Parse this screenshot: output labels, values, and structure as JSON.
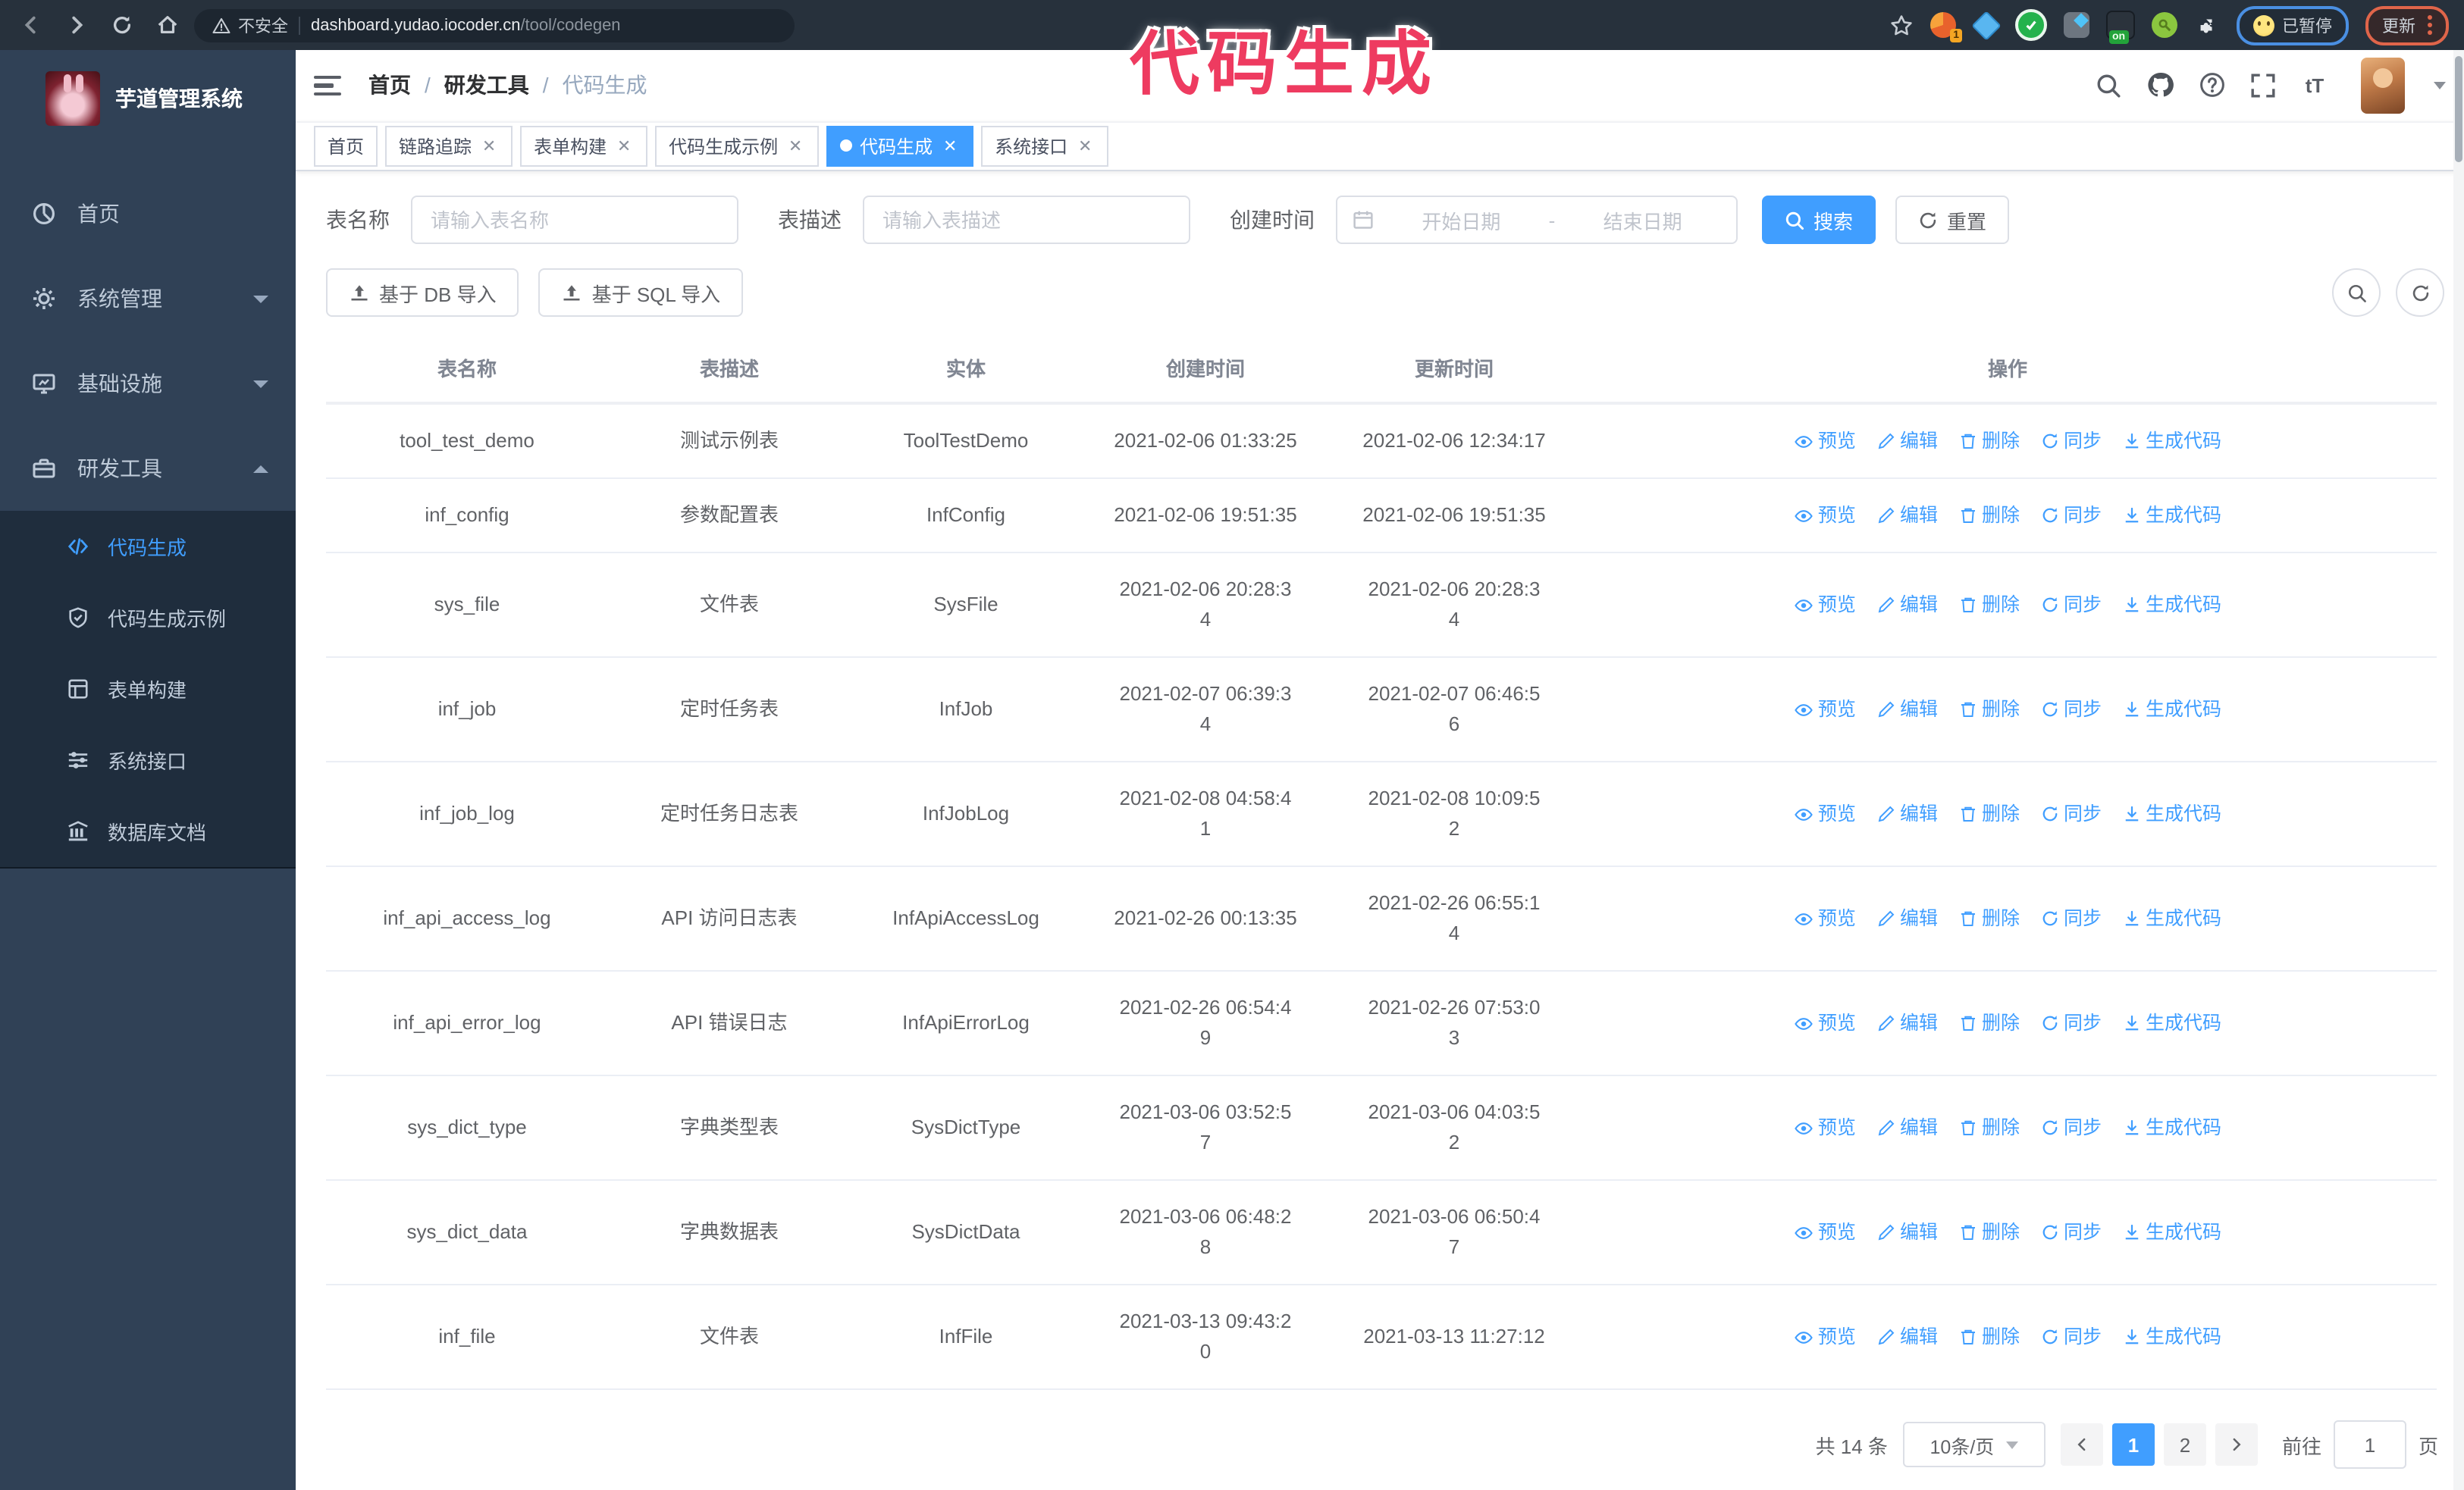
{
  "browser": {
    "security_label": "不安全",
    "url_domain": "dashboard.yudao.iocoder.cn",
    "url_path": "/tool/codegen",
    "extension_badge": "1",
    "extension_on_badge": "on",
    "paused_label": "已暂停",
    "update_label": "更新"
  },
  "overlay": {
    "text": "代码生成",
    "color": "#ee3b60"
  },
  "sidebar": {
    "title": "芋道管理系统",
    "items": [
      {
        "label": "首页"
      },
      {
        "label": "系统管理"
      },
      {
        "label": "基础设施"
      },
      {
        "label": "研发工具"
      }
    ],
    "subitems": [
      {
        "label": "代码生成",
        "active": true
      },
      {
        "label": "代码生成示例"
      },
      {
        "label": "表单构建"
      },
      {
        "label": "系统接口"
      },
      {
        "label": "数据库文档"
      }
    ]
  },
  "navbar": {
    "breadcrumb": [
      "首页",
      "研发工具",
      "代码生成"
    ],
    "separator": "/"
  },
  "tags": [
    {
      "label": "首页"
    },
    {
      "label": "链路追踪"
    },
    {
      "label": "表单构建"
    },
    {
      "label": "代码生成示例"
    },
    {
      "label": "代码生成",
      "active": true
    },
    {
      "label": "系统接口"
    }
  ],
  "filters": {
    "name_label": "表名称",
    "name_placeholder": "请输入表名称",
    "desc_label": "表描述",
    "desc_placeholder": "请输入表描述",
    "time_label": "创建时间",
    "start_placeholder": "开始日期",
    "range_separator": "-",
    "end_placeholder": "结束日期",
    "search_label": "搜索",
    "reset_label": "重置"
  },
  "toolbar": {
    "import_db_label": "基于 DB 导入",
    "import_sql_label": "基于 SQL 导入"
  },
  "table": {
    "headers": [
      "表名称",
      "表描述",
      "实体",
      "创建时间",
      "更新时间",
      "操作"
    ],
    "actions": [
      "预览",
      "编辑",
      "删除",
      "同步",
      "生成代码"
    ],
    "rows": [
      {
        "name": "tool_test_demo",
        "desc": "测试示例表",
        "entity": "ToolTestDemo",
        "created": "2021-02-06 01:33:25",
        "updated": "2021-02-06 12:34:17"
      },
      {
        "name": "inf_config",
        "desc": "参数配置表",
        "entity": "InfConfig",
        "created": "2021-02-06 19:51:35",
        "updated": "2021-02-06 19:51:35"
      },
      {
        "name": "sys_file",
        "desc": "文件表",
        "entity": "SysFile",
        "created": "2021-02-06 20:28:3\n4",
        "updated": "2021-02-06 20:28:3\n4"
      },
      {
        "name": "inf_job",
        "desc": "定时任务表",
        "entity": "InfJob",
        "created": "2021-02-07 06:39:3\n4",
        "updated": "2021-02-07 06:46:5\n6"
      },
      {
        "name": "inf_job_log",
        "desc": "定时任务日志表",
        "entity": "InfJobLog",
        "created": "2021-02-08 04:58:4\n1",
        "updated": "2021-02-08 10:09:5\n2"
      },
      {
        "name": "inf_api_access_log",
        "desc": "API 访问日志表",
        "entity": "InfApiAccessLog",
        "created": "2021-02-26 00:13:35",
        "updated": "2021-02-26 06:55:1\n4"
      },
      {
        "name": "inf_api_error_log",
        "desc": "API 错误日志",
        "entity": "InfApiErrorLog",
        "created": "2021-02-26 06:54:4\n9",
        "updated": "2021-02-26 07:53:0\n3"
      },
      {
        "name": "sys_dict_type",
        "desc": "字典类型表",
        "entity": "SysDictType",
        "created": "2021-03-06 03:52:5\n7",
        "updated": "2021-03-06 04:03:5\n2"
      },
      {
        "name": "sys_dict_data",
        "desc": "字典数据表",
        "entity": "SysDictData",
        "created": "2021-03-06 06:48:2\n8",
        "updated": "2021-03-06 06:50:4\n7"
      },
      {
        "name": "inf_file",
        "desc": "文件表",
        "entity": "InfFile",
        "created": "2021-03-13 09:43:2\n0",
        "updated": "2021-03-13 11:27:12"
      }
    ]
  },
  "pagination": {
    "total": "共 14 条",
    "size": "10条/页",
    "pages": [
      "1",
      "2"
    ],
    "goto_label": "前往",
    "goto_value": "1",
    "page_suffix": "页"
  },
  "colors": {
    "accent": "#409EFF",
    "sidebar_bg": "#304156",
    "submenu_bg": "#1f2d3d",
    "overlay_text": "#ee3b60",
    "browser_bar": "#27313c"
  }
}
